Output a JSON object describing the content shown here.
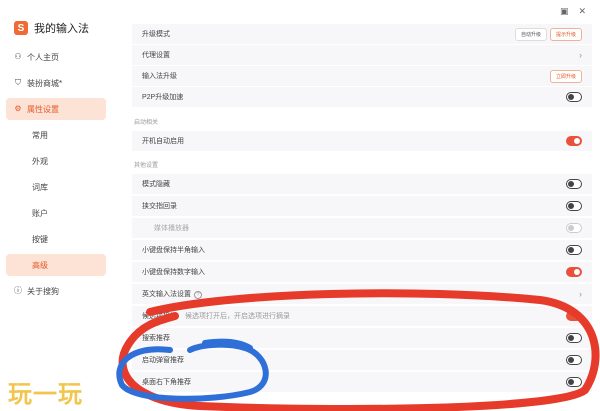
{
  "app": {
    "title": "我的输入法"
  },
  "window": {
    "restore_icon": "restore-icon",
    "close_icon": "close-icon"
  },
  "sidebar": {
    "items": [
      {
        "label": "个人主页",
        "icon": "user-icon"
      },
      {
        "label": "装扮商城*",
        "icon": "shield-icon"
      },
      {
        "label": "属性设置",
        "icon": "settings-icon",
        "active": true
      },
      {
        "label": "常用"
      },
      {
        "label": "外观"
      },
      {
        "label": "词库"
      },
      {
        "label": "账户"
      },
      {
        "label": "按键"
      },
      {
        "label": "高级",
        "active": true
      },
      {
        "label": "关于搜狗",
        "icon": "info-icon"
      }
    ]
  },
  "main": {
    "top_rows": [
      {
        "label": "升级模式",
        "btn1": "自动升级",
        "btn2": "提示升级"
      },
      {
        "label": "代理设置"
      },
      {
        "label": "输入法升级",
        "button": "立即升级"
      },
      {
        "label": "P2P升级加速"
      }
    ],
    "section1": {
      "title": "启动相关",
      "rows": [
        {
          "label": "开机自动启用"
        }
      ]
    },
    "section2": {
      "title": "其他设置",
      "rows": [
        {
          "label": "模式隐藏"
        },
        {
          "label": "挟交指回录"
        },
        {
          "label": "媒体播放器"
        },
        {
          "label": "小键盘保持半角输入"
        },
        {
          "label": "小键盘保持数字输入"
        },
        {
          "label": "英文输入法设置"
        },
        {
          "label": "候选项摘录",
          "note": "候选项打开后，开启选项进行摘录"
        },
        {
          "label": "搜索推荐"
        },
        {
          "label": "启动弹窗推荐"
        },
        {
          "label": "桌面右下角推荐"
        }
      ]
    }
  },
  "watermark": "玩一玩",
  "colors": {
    "accent": "#e8523b",
    "red_mark": "#e63a2b",
    "blue_mark": "#2f6fd8"
  }
}
